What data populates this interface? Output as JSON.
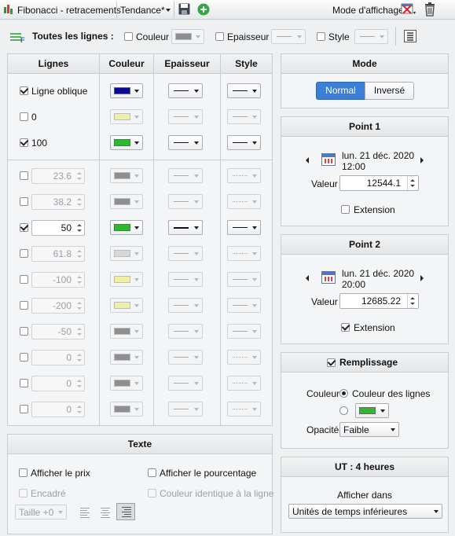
{
  "toolbar": {
    "title": "Fibonacci - retracements",
    "style_select": "Tendance*",
    "display_mode_label": "Mode d'affichage"
  },
  "all_lines": {
    "label": "Toutes les lignes :",
    "color_label": "Couleur",
    "thickness_label": "Epaisseur",
    "style_label": "Style"
  },
  "lines_table": {
    "headers": [
      "Lignes",
      "Couleur",
      "Epaisseur",
      "Style"
    ],
    "fixed_rows": [
      {
        "label": "Ligne oblique",
        "checked": true,
        "color": "#0a0a8c",
        "enabled": true
      },
      {
        "label": "0",
        "checked": false,
        "color": "#f0f0a0",
        "enabled": false
      },
      {
        "label": "100",
        "checked": true,
        "color": "#2eb82e",
        "enabled": true
      }
    ],
    "level_rows": [
      {
        "value": "23.6",
        "checked": false,
        "color": "#8f8f8f",
        "enabled": false,
        "style": "dotted"
      },
      {
        "value": "38.2",
        "checked": false,
        "color": "#8f8f8f",
        "enabled": false,
        "style": "dotted"
      },
      {
        "value": "50",
        "checked": true,
        "color": "#2eb82e",
        "enabled": true,
        "style": "solid"
      },
      {
        "value": "61.8",
        "checked": false,
        "color": "#d8d8d8",
        "enabled": false,
        "style": "dotted"
      },
      {
        "value": "-100",
        "checked": false,
        "color": "#f0f0a0",
        "enabled": false,
        "style": "solid"
      },
      {
        "value": "-200",
        "checked": false,
        "color": "#f0f0a0",
        "enabled": false,
        "style": "solid"
      },
      {
        "value": "-50",
        "checked": false,
        "color": "#8f8f8f",
        "enabled": false,
        "style": "solid"
      },
      {
        "value": "0",
        "checked": false,
        "color": "#8f8f8f",
        "enabled": false,
        "style": "dotted"
      },
      {
        "value": "0",
        "checked": false,
        "color": "#8f8f8f",
        "enabled": false,
        "style": "dotted"
      },
      {
        "value": "0",
        "checked": false,
        "color": "#8f8f8f",
        "enabled": false,
        "style": "dotted"
      }
    ]
  },
  "text_panel": {
    "title": "Texte",
    "show_price": "Afficher le prix",
    "show_percentage": "Afficher le pourcentage",
    "framed": "Encadré",
    "same_color": "Couleur identique à la ligne",
    "size": "Taille +0"
  },
  "mode_panel": {
    "title": "Mode",
    "normal": "Normal",
    "inverse": "Inversé"
  },
  "point1": {
    "title": "Point 1",
    "date": "lun. 21 déc. 2020",
    "time": "12:00",
    "value_label": "Valeur",
    "value": "12544.1",
    "extension_label": "Extension",
    "extension_checked": false
  },
  "point2": {
    "title": "Point 2",
    "date": "lun. 21 déc. 2020",
    "time": "20:00",
    "value_label": "Valeur",
    "value": "12685.22",
    "extension_label": "Extension",
    "extension_checked": true
  },
  "fill_panel": {
    "title": "Remplissage",
    "color_label": "Couleur",
    "line_colors_option": "Couleur des lignes",
    "custom_color": "#2eb82e",
    "opacity_label": "Opacité",
    "opacity_value": "Faible"
  },
  "timeframe_panel": {
    "title": "UT : 4 heures",
    "show_in_label": "Afficher dans",
    "show_in_value": "Unités de temps inférieures"
  },
  "colors": {
    "accent": "#3d7fd6",
    "panel_bg": "#f4f5f6"
  }
}
